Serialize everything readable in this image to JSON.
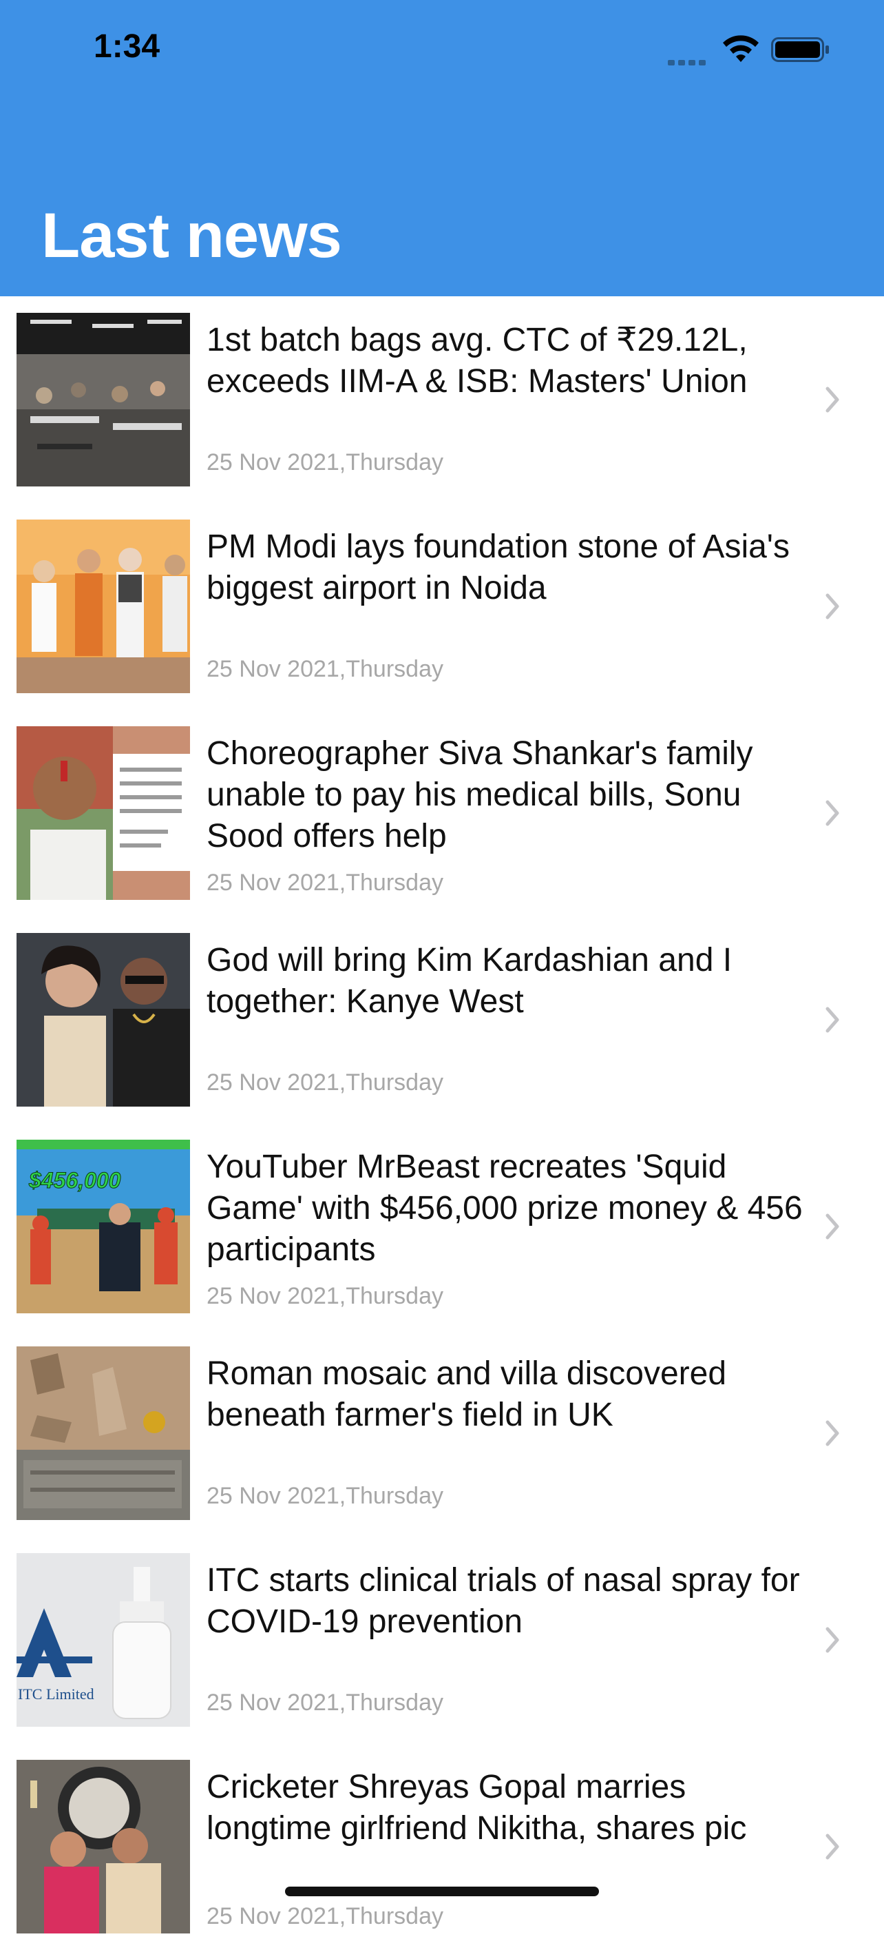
{
  "status_bar": {
    "time": "1:34"
  },
  "header": {
    "title": "Last news"
  },
  "articles": [
    {
      "headline": "1st batch bags avg. CTC of ₹29.12L, exceeds IIM-A & ISB: Masters' Union",
      "date": "25 Nov 2021,Thursday"
    },
    {
      "headline": "PM Modi lays foundation stone of Asia's biggest airport in Noida",
      "date": "25 Nov 2021,Thursday"
    },
    {
      "headline": "Choreographer Siva Shankar's family unable to pay his medical bills, Sonu Sood offers help",
      "date": "25 Nov 2021,Thursday"
    },
    {
      "headline": "God will bring Kim Kardashian and I together: Kanye West",
      "date": "25 Nov 2021,Thursday"
    },
    {
      "headline": "YouTuber MrBeast recreates 'Squid Game' with $456,000 prize money & 456 participants",
      "date": "25 Nov 2021,Thursday",
      "thumb_text": "$456,000"
    },
    {
      "headline": "Roman mosaic and villa discovered beneath farmer's field in UK",
      "date": "25 Nov 2021,Thursday"
    },
    {
      "headline": "ITC starts clinical trials of nasal spray for COVID-19 prevention",
      "date": "25 Nov 2021,Thursday",
      "thumb_text": "ITC Limited"
    },
    {
      "headline": "Cricketer Shreyas Gopal marries longtime girlfriend Nikitha, shares pic",
      "date": "25 Nov 2021,Thursday"
    }
  ],
  "colors": {
    "header_bg": "#3e91e6",
    "title_text": "#ffffff",
    "date_text": "#a7a7a7",
    "chevron": "#c4c4c7"
  },
  "icons": {
    "chevron": "chevron-right-icon",
    "wifi": "wifi-icon",
    "battery": "battery-icon"
  }
}
